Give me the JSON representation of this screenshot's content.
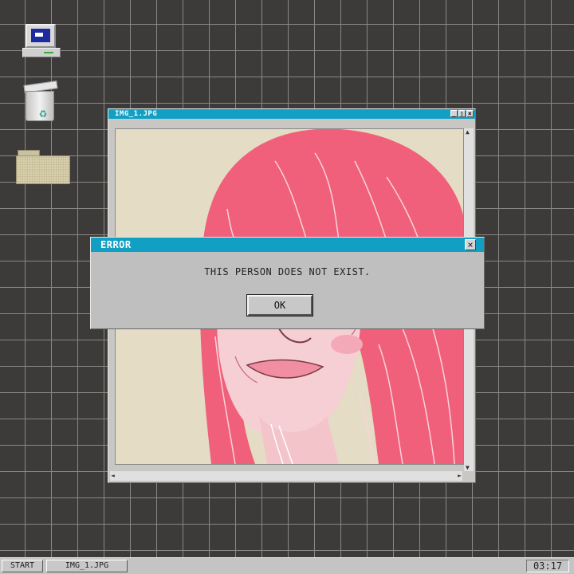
{
  "desktop": {
    "icons": [
      {
        "name": "computer"
      },
      {
        "name": "recycle-bin"
      },
      {
        "name": "folder"
      }
    ]
  },
  "image_window": {
    "title": "IMG_1.JPG",
    "buttons": [
      "_",
      "▯",
      "×"
    ]
  },
  "error_dialog": {
    "title": "ERROR",
    "close_label": "×",
    "message": "THIS PERSON DOES NOT EXIST.",
    "ok_label": "OK"
  },
  "taskbar": {
    "start_label": "START",
    "task_label": "IMG_1.JPG",
    "clock": "03:17"
  },
  "colors": {
    "desktop_bg": "#3d3b39",
    "titlebar": "#11a0c4",
    "hair": "#f0607a",
    "skin": "#f6cfd4",
    "image_bg": "#e4dcc5"
  }
}
